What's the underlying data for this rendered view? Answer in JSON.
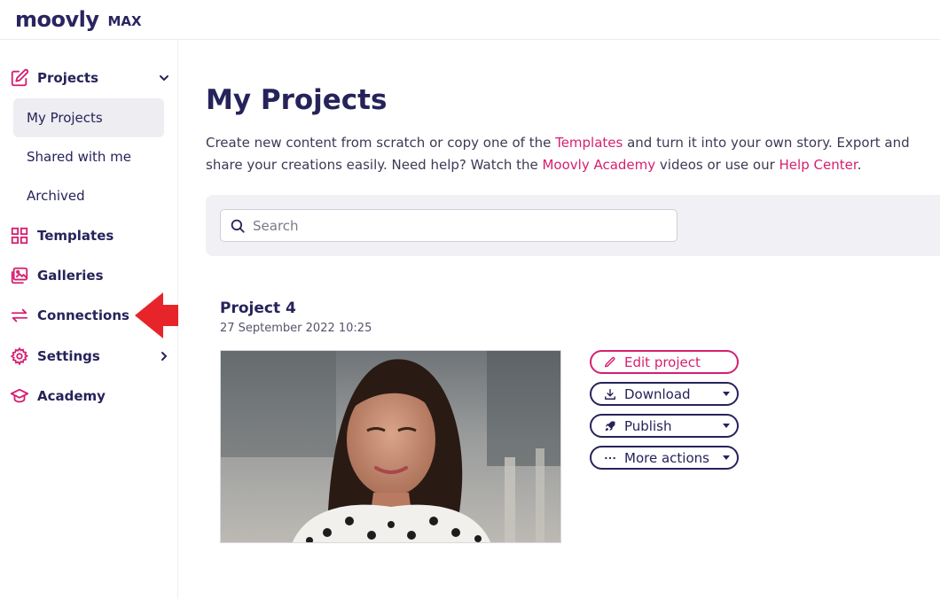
{
  "app": {
    "logo_text": "moovly",
    "logo_badge": "MAX"
  },
  "sidebar": {
    "items": [
      {
        "label": "Projects",
        "icon": "edit-square-icon"
      },
      {
        "label": "Templates",
        "icon": "grid-icon"
      },
      {
        "label": "Galleries",
        "icon": "gallery-icon"
      },
      {
        "label": "Connections",
        "icon": "arrows-exchange-icon"
      },
      {
        "label": "Settings",
        "icon": "gear-icon"
      },
      {
        "label": "Academy",
        "icon": "graduation-cap-icon"
      }
    ],
    "project_subitems": [
      {
        "label": "My Projects",
        "active": true
      },
      {
        "label": "Shared with me"
      },
      {
        "label": "Archived"
      }
    ]
  },
  "main": {
    "title": "My Projects",
    "intro": {
      "part1": "Create new content from scratch or copy one of the ",
      "link1": "Templates",
      "part2": " and turn it into your own story. Export and share your creations easily. Need help? Watch the ",
      "link2": "Moovly Academy",
      "part3": " videos or use our ",
      "link3": "Help Center",
      "part4": "."
    },
    "search": {
      "placeholder": "Search"
    },
    "project": {
      "title": "Project 4",
      "date": "27 September 2022 10:25",
      "actions": {
        "edit": "Edit project",
        "download": "Download",
        "publish": "Publish",
        "more": "More actions"
      }
    }
  },
  "colors": {
    "accent": "#d61f6f",
    "primary": "#26235a",
    "arrow": "#e8242b"
  }
}
